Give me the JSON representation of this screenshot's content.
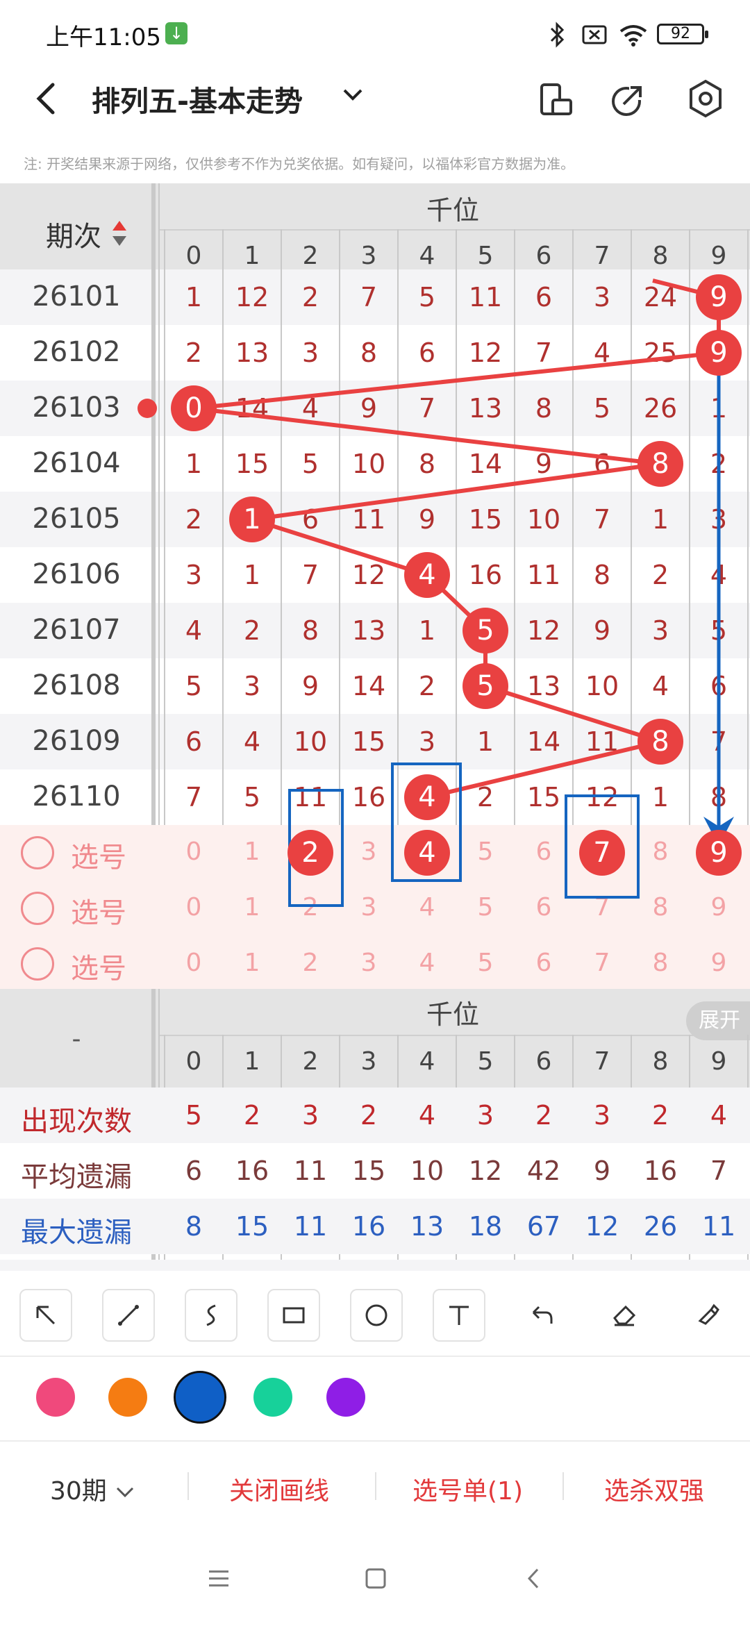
{
  "status": {
    "time": "上午11:05",
    "battery": "92"
  },
  "header": {
    "title": "排列五-基本走势"
  },
  "disclaimer": "注: 开奖结果来源于网络，仅供参考不作为兑奖依据。如有疑问，以福体彩官方数据为准。",
  "table": {
    "issue_header": "期次",
    "section_title": "千位",
    "digits": [
      "0",
      "1",
      "2",
      "3",
      "4",
      "5",
      "6",
      "7",
      "8",
      "9"
    ],
    "rows": [
      {
        "issue": "26101",
        "cells": [
          "1",
          "12",
          "2",
          "7",
          "5",
          "11",
          "6",
          "3",
          "24",
          "9"
        ],
        "hit": 9
      },
      {
        "issue": "26102",
        "cells": [
          "2",
          "13",
          "3",
          "8",
          "6",
          "12",
          "7",
          "4",
          "25",
          "9"
        ],
        "hit": 9
      },
      {
        "issue": "26103",
        "cells": [
          "0",
          "14",
          "4",
          "9",
          "7",
          "13",
          "8",
          "5",
          "26",
          "1"
        ],
        "hit": 0
      },
      {
        "issue": "26104",
        "cells": [
          "1",
          "15",
          "5",
          "10",
          "8",
          "14",
          "9",
          "6",
          "8",
          "2"
        ],
        "hit": 8
      },
      {
        "issue": "26105",
        "cells": [
          "2",
          "1",
          "6",
          "11",
          "9",
          "15",
          "10",
          "7",
          "1",
          "3"
        ],
        "hit": 1
      },
      {
        "issue": "26106",
        "cells": [
          "3",
          "1",
          "7",
          "12",
          "4",
          "16",
          "11",
          "8",
          "2",
          "4"
        ],
        "hit": 4
      },
      {
        "issue": "26107",
        "cells": [
          "4",
          "2",
          "8",
          "13",
          "1",
          "5",
          "12",
          "9",
          "3",
          "5"
        ],
        "hit": 5
      },
      {
        "issue": "26108",
        "cells": [
          "5",
          "3",
          "9",
          "14",
          "2",
          "5",
          "13",
          "10",
          "4",
          "6"
        ],
        "hit": 5
      },
      {
        "issue": "26109",
        "cells": [
          "6",
          "4",
          "10",
          "15",
          "3",
          "1",
          "14",
          "11",
          "8",
          "7"
        ],
        "hit": 8
      },
      {
        "issue": "26110",
        "cells": [
          "7",
          "5",
          "11",
          "16",
          "4",
          "2",
          "15",
          "12",
          "1",
          "8"
        ],
        "hit": 4
      }
    ],
    "pick_label": "选号",
    "pick_rows": [
      {
        "selected": [
          2,
          4,
          7,
          9
        ]
      },
      {
        "selected": []
      },
      {
        "selected": []
      }
    ]
  },
  "stats": {
    "section_dash": "-",
    "section_title": "千位",
    "expand_label": "展开",
    "rows": [
      {
        "label": "出现次数",
        "color": "#c0282c",
        "values": [
          "5",
          "2",
          "3",
          "2",
          "4",
          "3",
          "2",
          "3",
          "2",
          "4"
        ]
      },
      {
        "label": "平均遗漏",
        "color": "#7a3a3a",
        "values": [
          "6",
          "16",
          "11",
          "15",
          "10",
          "12",
          "42",
          "9",
          "16",
          "7"
        ]
      },
      {
        "label": "最大遗漏",
        "color": "#2c5fc0",
        "values": [
          "8",
          "15",
          "11",
          "16",
          "13",
          "18",
          "67",
          "12",
          "26",
          "11"
        ]
      }
    ]
  },
  "toolbar": {
    "tools": [
      "arrow-tool",
      "line-tool",
      "curve-tool",
      "rect-tool",
      "circle-tool",
      "text-tool",
      "undo-tool",
      "eraser-tool",
      "clear-tool"
    ],
    "colors": [
      "#f0497c",
      "#f57c12",
      "#0f5fc6",
      "#17d19a",
      "#8f1ee6"
    ],
    "selected_color": 2
  },
  "bottom": {
    "periods": "30期",
    "close_lines": "关闭画线",
    "pick_list": "选号单(1)",
    "filter": "选杀双强"
  }
}
